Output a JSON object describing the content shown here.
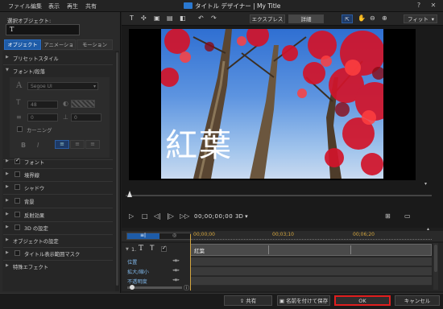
{
  "menu": {
    "items": [
      "ファイル",
      "編集",
      "表示",
      "再生",
      "共有"
    ]
  },
  "window": {
    "title": "タイトル デザイナー | My Title"
  },
  "left_panel": {
    "select_object_label": "選択オブジェクト:",
    "selected_object_glyph": "T",
    "tabs": [
      "オブジェクト",
      "アニメーション",
      "モーション"
    ],
    "sections": {
      "preset_style": "プリセットスタイル",
      "font_paragraph": "フォント/段落",
      "font_name": "Segoe UI",
      "font_size": "48",
      "spacing_a": "0",
      "spacing_b": "0",
      "kerning": "カーニング",
      "font": "フォント",
      "border": "境界線",
      "shadow": "シャドウ",
      "background": "背景",
      "reflection": "反射効果",
      "three_d": "3D の設定",
      "object_settings": "オブジェクトの設定",
      "title_safe_mask": "タイトル表示範囲マスク",
      "special_effect": "特殊エフェクト"
    }
  },
  "toolbar": {
    "express_label": "エクスプレス",
    "detail_label": "詳細",
    "fit_label": "フィット"
  },
  "preview": {
    "title_text": "紅葉"
  },
  "playback": {
    "timecode": "00;00;00;00",
    "mode_3d": "3D"
  },
  "timeline": {
    "marks": [
      "00;00;00",
      "00;03;10",
      "00;06;20"
    ],
    "track_number": "1.",
    "clip_label": "紅葉",
    "rows": [
      "位置",
      "拡大/縮小",
      "不透明度"
    ]
  },
  "bottom": {
    "share_label": "共有",
    "save_as_label": "名前を付けて保存",
    "ok_label": "OK",
    "cancel_label": "キャンセル"
  },
  "colors": {
    "accent": "#1e5ca8",
    "highlight_border": "#e01e1e",
    "timecode_mark": "#d4a640",
    "leaf_red": "#d2142a"
  }
}
